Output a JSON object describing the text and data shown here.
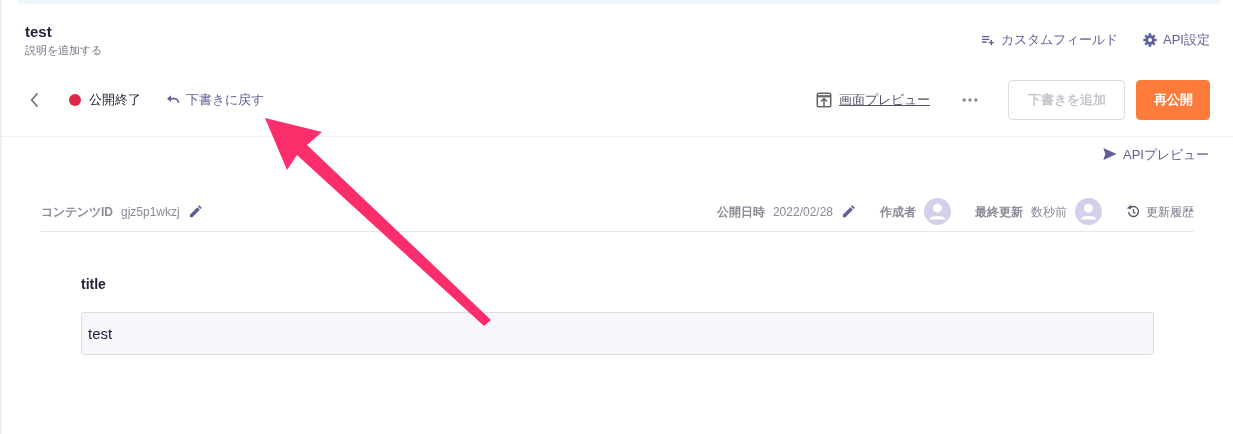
{
  "header": {
    "title": "test",
    "description": "説明を追加する",
    "actions": [
      {
        "kind": "custom-field",
        "label": "カスタムフィールド"
      },
      {
        "kind": "settings",
        "label": "API設定"
      }
    ]
  },
  "toolbar": {
    "status": "公開終了",
    "revert_link": "下書きに戻す",
    "preview_link": "画面プレビュー",
    "buttons": [
      {
        "label": "下書きを追加",
        "disabled": true
      },
      {
        "label": "再公開",
        "disabled": false
      }
    ]
  },
  "api_preview": "APIプレビュー",
  "meta": {
    "content_id_label": "コンテンツID",
    "content_id": "gjz5p1wkzj",
    "published_label": "公開日時",
    "published": "2022/02/28",
    "author_label": "作成者",
    "updated_label": "最終更新",
    "updated": "数秒前",
    "history_link": "更新履歴"
  },
  "field": {
    "label": "title",
    "value": "test"
  }
}
